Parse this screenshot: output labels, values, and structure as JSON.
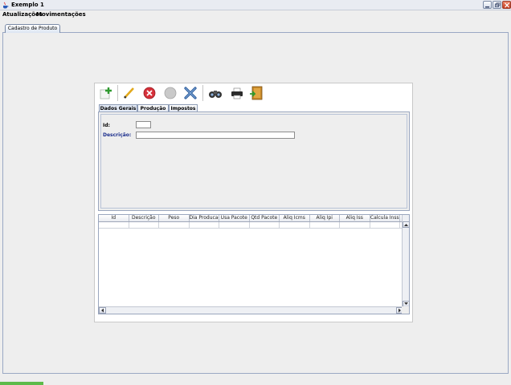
{
  "window": {
    "title": "Exemplo 1"
  },
  "menubar": {
    "items": [
      "Atualizações",
      "Movimentações"
    ]
  },
  "outer_tab": {
    "label": "Cadastro de Produto"
  },
  "toolbar": {
    "buttons": [
      "add-icon",
      "edit-icon",
      "cancel-icon",
      "confirm-icon",
      "delete-icon",
      "search-icon",
      "print-icon",
      "exit-icon"
    ]
  },
  "inner_tabs": [
    "Dados Gerais",
    "Produção",
    "Impostos"
  ],
  "form": {
    "id_label": "Id:",
    "id_value": "",
    "descricao_label": "Descrição:",
    "descricao_value": ""
  },
  "table": {
    "columns": [
      "Id",
      "Descrição",
      "Peso",
      "Dia Producao",
      "Usa Pacote",
      "Qtd Pacote",
      "Aliq Icms",
      "Aliq Ipi",
      "Aliq Iss",
      "Calcula Inss"
    ],
    "rows": [
      [
        "",
        "",
        "",
        "",
        "",
        "",
        "",
        "",
        "",
        ""
      ]
    ]
  },
  "colors": {
    "accent": "#1a2d8c",
    "close_button": "#c2381a",
    "status": "#5dbb4a"
  }
}
